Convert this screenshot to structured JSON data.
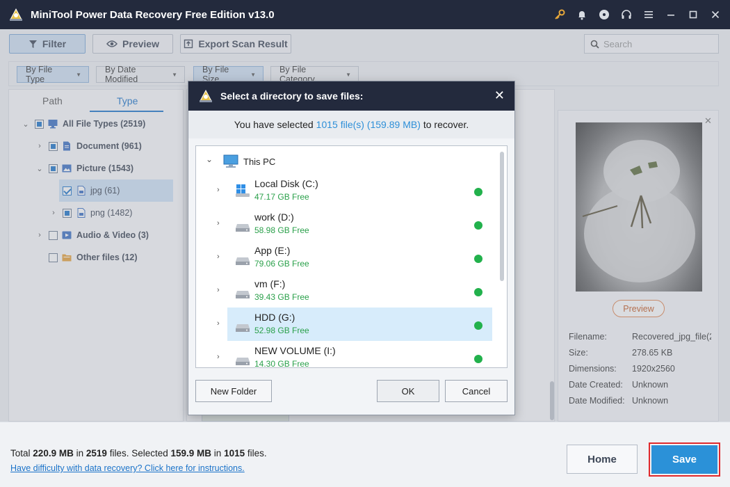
{
  "window": {
    "title": "MiniTool Power Data Recovery Free Edition v13.0",
    "icons": [
      "key-icon",
      "bell-icon",
      "disc-icon",
      "headset-icon",
      "menu-icon",
      "minimize-icon",
      "maximize-icon",
      "close-icon"
    ]
  },
  "toolbar": {
    "filter_label": "Filter",
    "preview_label": "Preview",
    "export_label": "Export Scan Result",
    "search_placeholder": "Search"
  },
  "filters": [
    {
      "label": "By File Type",
      "active": true
    },
    {
      "label": "By Date Modified",
      "active": false
    },
    {
      "label": "By File Size",
      "active": true
    },
    {
      "label": "By File Category",
      "active": false
    }
  ],
  "tabs": {
    "path": "Path",
    "type": "Type",
    "active": "Type"
  },
  "tree": [
    {
      "label": "All File Types (2519)",
      "expanded": true
    },
    {
      "label": "Document (961)",
      "expanded": false
    },
    {
      "label": "Picture (1543)",
      "expanded": true
    },
    {
      "label": "jpg (61)",
      "checked": true,
      "selected": true
    },
    {
      "label": "png (1482)",
      "expanded": false
    },
    {
      "label": "Audio & Video (3)",
      "expanded": false
    },
    {
      "label": "Other files (12)",
      "expanded": false
    }
  ],
  "preview": {
    "button_label": "Preview",
    "meta": [
      {
        "key": "Filename:",
        "value": "Recovered_jpg_file(2"
      },
      {
        "key": "Size:",
        "value": "278.65 KB"
      },
      {
        "key": "Dimensions:",
        "value": "1920x2560"
      },
      {
        "key": "Date Created:",
        "value": "Unknown"
      },
      {
        "key": "Date Modified:",
        "value": "Unknown"
      }
    ]
  },
  "dialog": {
    "title": "Select a directory to save files:",
    "info_prefix": "You have selected",
    "info_highlight": "1015 file(s) (159.89 MB)",
    "info_suffix": "to recover.",
    "root": "This PC",
    "drives": [
      {
        "name": "Local Disk (C:)",
        "free": "47.17 GB Free",
        "type": "windows"
      },
      {
        "name": "work (D:)",
        "free": "58.98 GB Free",
        "type": "disk"
      },
      {
        "name": "App (E:)",
        "free": "79.06 GB Free",
        "type": "disk"
      },
      {
        "name": "vm (F:)",
        "free": "39.43 GB Free",
        "type": "disk"
      },
      {
        "name": "HDD (G:)",
        "free": "52.98 GB Free",
        "type": "disk",
        "selected": true
      },
      {
        "name": "NEW VOLUME (I:)",
        "free": "14.30 GB Free",
        "type": "disk"
      }
    ],
    "new_folder_label": "New Folder",
    "ok_label": "OK",
    "cancel_label": "Cancel"
  },
  "bottom": {
    "total_prefix": "Total",
    "total_size": "220.9 MB",
    "in1": "in",
    "total_files": "2519",
    "files1": "files.  Selected",
    "selected_size": "159.9 MB",
    "in2": "in",
    "selected_files": "1015",
    "files2": "files.",
    "help_link": "Have difficulty with data recovery? Click here for instructions.",
    "home_label": "Home",
    "save_label": "Save"
  },
  "colors": {
    "titlebar": "#232a3d",
    "accent": "#1b73c9",
    "save": "#2b91d8",
    "free_space": "#2aa04a",
    "status_dot": "#22b14c",
    "highlight_border": "#e0292c"
  }
}
